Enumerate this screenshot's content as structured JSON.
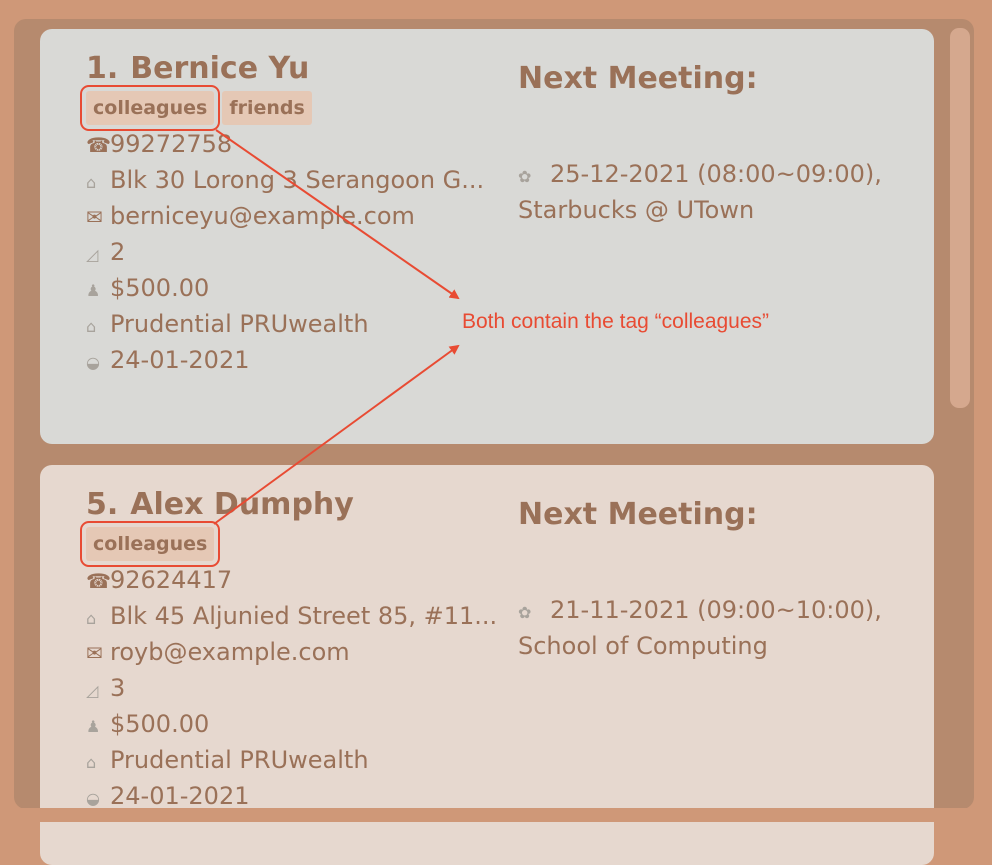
{
  "persons": [
    {
      "index": "1.",
      "name": "Bernice Yu",
      "tags": [
        "colleagues",
        "friends"
      ],
      "phone": "99272758",
      "address": "Blk 30 Lorong 3 Serangoon G...",
      "email": "berniceyu@example.com",
      "risk": "2",
      "income": "$500.00",
      "policy": "Prudential PRUwealth",
      "date": "24-01-2021",
      "next_meeting_title": "Next Meeting:",
      "meeting_time": "25-12-2021 (08:00~09:00),",
      "meeting_place": "Starbucks @ UTown"
    },
    {
      "index": "5.",
      "name": "Alex Dumphy",
      "tags": [
        "colleagues"
      ],
      "phone": "92624417",
      "address": "Blk 45 Aljunied Street 85, #11...",
      "email": "royb@example.com",
      "risk": "3",
      "income": "$500.00",
      "policy": "Prudential PRUwealth",
      "date": "24-01-2021",
      "next_meeting_title": "Next Meeting:",
      "meeting_time": "21-11-2021 (09:00~10:00),",
      "meeting_place": "School of Computing"
    }
  ],
  "annotation": {
    "text": "Both contain the tag “colleagues”",
    "color": "#e84b33"
  },
  "icons": {
    "phone": "phone-icon",
    "address": "house-icon",
    "email": "envelope-icon",
    "risk": "chart-icon",
    "income": "money-bag-icon",
    "policy": "bank-icon",
    "date": "handshake-icon",
    "meeting": "calendar-icon"
  },
  "colors": {
    "background": "#cf9878",
    "panel": "#b68a6e",
    "card_selected": "#d9d9d6",
    "card": "#e6d8cf",
    "text": "#9a7158",
    "tag_bg": "#e5c8b5"
  }
}
